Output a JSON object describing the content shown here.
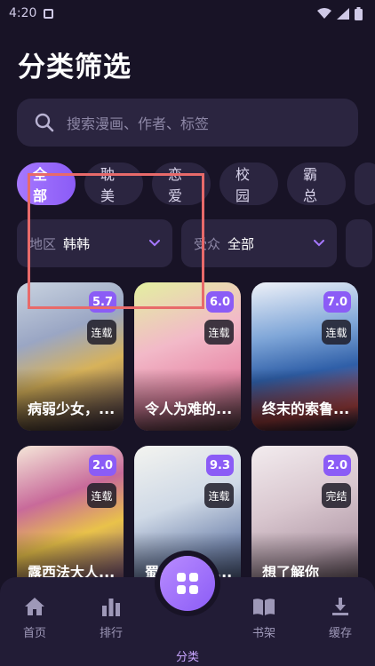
{
  "status_bar": {
    "time": "4:20"
  },
  "header": {
    "title": "分类筛选"
  },
  "search": {
    "placeholder": "搜索漫画、作者、标签"
  },
  "genres": [
    "全部",
    "耽美",
    "恋爱",
    "校园",
    "霸总"
  ],
  "filters": [
    {
      "label": "地区",
      "value": "韩韩"
    },
    {
      "label": "受众",
      "value": "全部"
    }
  ],
  "comics": [
    {
      "title": "病弱少女，...",
      "score": "5.7",
      "status": "连载"
    },
    {
      "title": "令人为难的...",
      "score": "6.0",
      "status": "连载"
    },
    {
      "title": "终末的索鲁...",
      "score": "7.0",
      "status": "连载"
    },
    {
      "title": "露西法大人...",
      "score": "2.0",
      "status": "连载"
    },
    {
      "title": "蜀黍和定画...",
      "score": "9.3",
      "status": "连载"
    },
    {
      "title": "想了解你",
      "score": "2.0",
      "status": "完结"
    }
  ],
  "nav": {
    "home": "首页",
    "rank": "排行",
    "category": "分类",
    "shelf": "书架",
    "cache": "缓存"
  },
  "colors": {
    "accent": "#8b5cf6",
    "background": "#181326",
    "surface": "#2b2540"
  }
}
